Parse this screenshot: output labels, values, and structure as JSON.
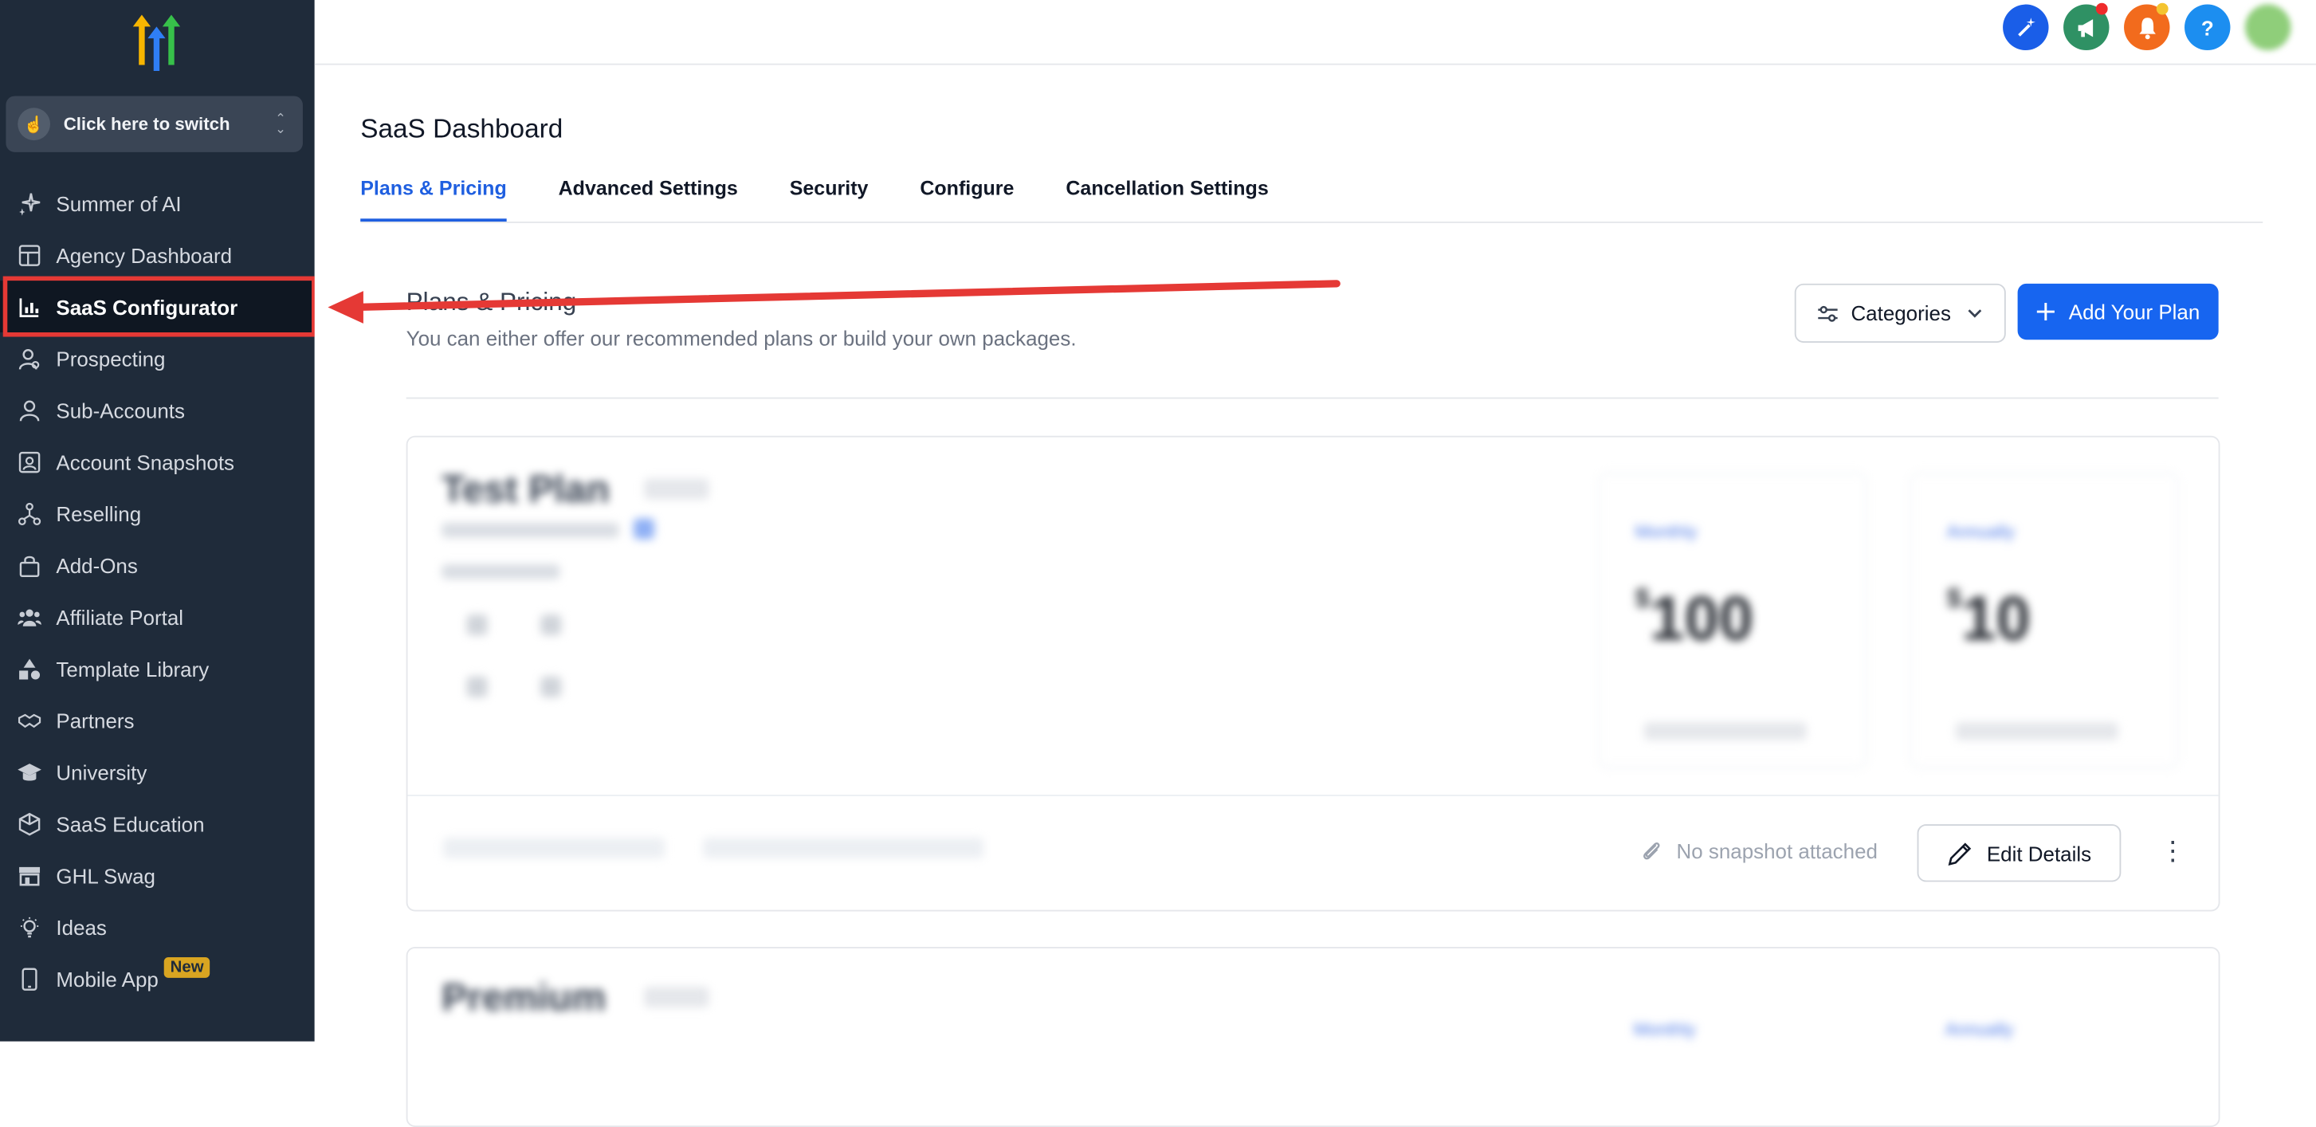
{
  "switcher": {
    "label": "Click here to switch"
  },
  "sidebar": {
    "items": [
      {
        "label": "Summer of AI"
      },
      {
        "label": "Agency Dashboard"
      },
      {
        "label": "SaaS Configurator"
      },
      {
        "label": "Prospecting"
      },
      {
        "label": "Sub-Accounts"
      },
      {
        "label": "Account Snapshots"
      },
      {
        "label": "Reselling"
      },
      {
        "label": "Add-Ons"
      },
      {
        "label": "Affiliate Portal"
      },
      {
        "label": "Template Library"
      },
      {
        "label": "Partners"
      },
      {
        "label": "University"
      },
      {
        "label": "SaaS Education"
      },
      {
        "label": "GHL Swag"
      },
      {
        "label": "Ideas"
      },
      {
        "label": "Mobile App",
        "badge": "New"
      }
    ]
  },
  "topbar": {
    "help_label": "?"
  },
  "page": {
    "title": "SaaS Dashboard"
  },
  "tabs": [
    {
      "label": "Plans & Pricing"
    },
    {
      "label": "Advanced Settings"
    },
    {
      "label": "Security"
    },
    {
      "label": "Configure"
    },
    {
      "label": "Cancellation Settings"
    }
  ],
  "section": {
    "title": "Plans & Pricing",
    "subtitle": "You can either offer our recommended plans or build your own packages.",
    "categories_label": "Categories",
    "add_plan_label": "Add Your Plan"
  },
  "plans": [
    {
      "name": "Test Plan",
      "prices": [
        {
          "period": "Monthly",
          "currency": "$",
          "amount": "100"
        },
        {
          "period": "Annually",
          "currency": "$",
          "amount": "10"
        }
      ],
      "snapshot_text": "No snapshot attached",
      "edit_label": "Edit Details"
    },
    {
      "name": "Premium",
      "prices": [
        {
          "period": "Monthly"
        },
        {
          "period": "Annually"
        }
      ]
    }
  ],
  "colors": {
    "accent": "#1765f0",
    "sidebar_bg": "#1f2b3a",
    "highlight": "#e53935"
  }
}
